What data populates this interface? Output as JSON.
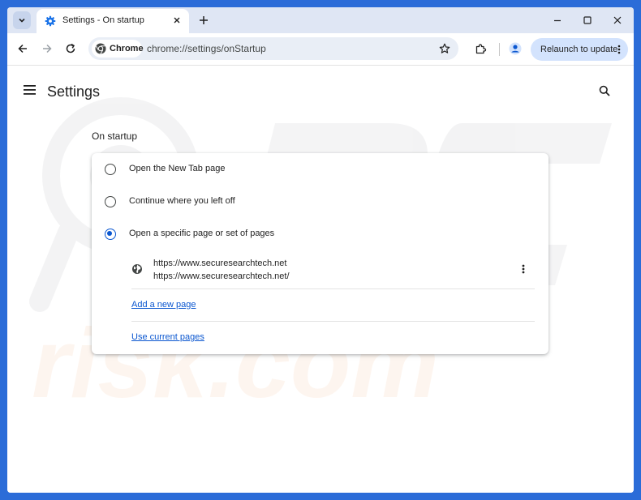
{
  "colors": {
    "desktop": "#2b6cd8",
    "tabstrip": "#dfe6f4",
    "accent": "#0b57d0",
    "relaunch_bg": "#d3e3fd"
  },
  "browser": {
    "tab": {
      "title": "Settings - On startup",
      "favicon": "gear-icon"
    },
    "chip_label": "Chrome",
    "url": "chrome://settings/onStartup",
    "relaunch_label": "Relaunch to update"
  },
  "settings": {
    "title": "Settings",
    "section_title": "On startup",
    "options": [
      {
        "label": "Open the New Tab page",
        "selected": false
      },
      {
        "label": "Continue where you left off",
        "selected": false
      },
      {
        "label": "Open a specific page or set of pages",
        "selected": true
      }
    ],
    "startup_page": {
      "title": "https://www.securesearchtech.net",
      "url": "https://www.securesearchtech.net/"
    },
    "add_page_label": "Add a new page",
    "use_current_label": "Use current pages"
  }
}
